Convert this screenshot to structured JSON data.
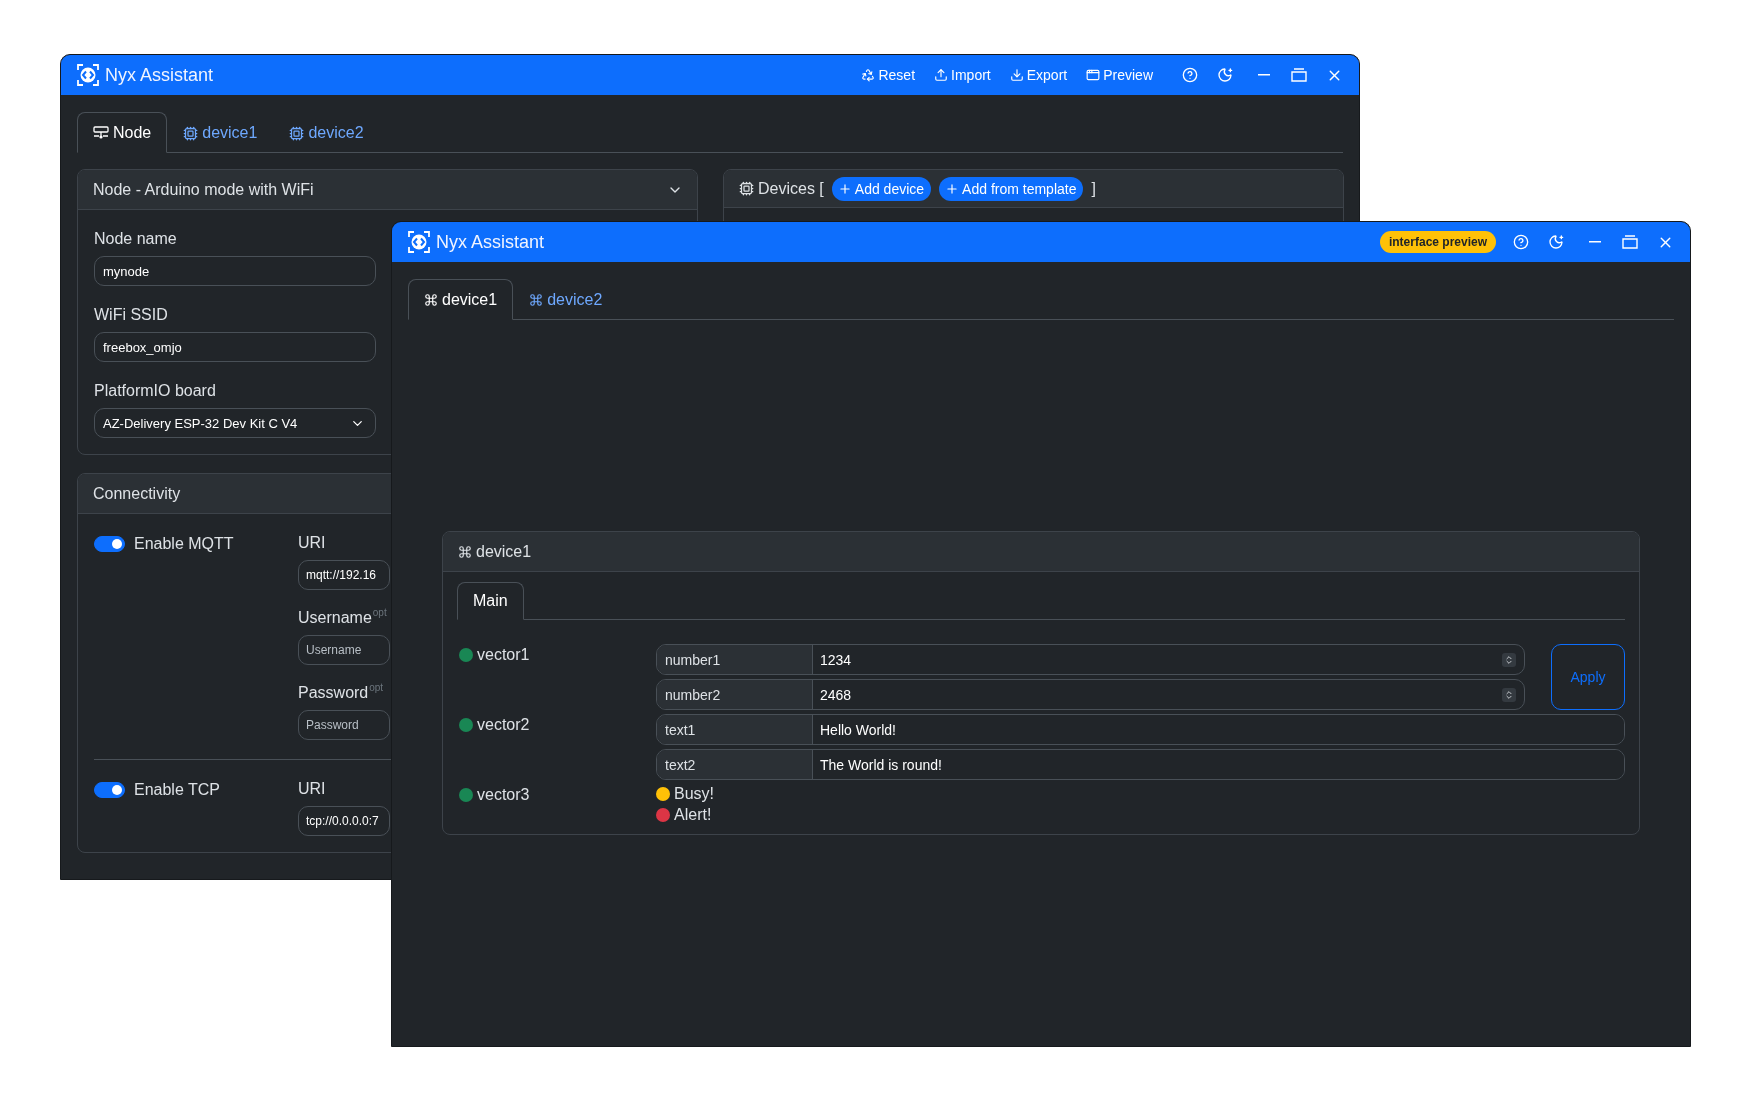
{
  "back_window": {
    "title": "Nyx Assistant",
    "toolbar": [
      {
        "label": "Reset",
        "kind": "reset"
      },
      {
        "label": "Import",
        "kind": "import"
      },
      {
        "label": "Export",
        "kind": "export"
      },
      {
        "label": "Preview",
        "kind": "preview"
      }
    ],
    "tabs": [
      {
        "label": "Node",
        "kind": "node",
        "selected": true
      },
      {
        "label": "device1",
        "kind": "device",
        "selected": false
      },
      {
        "label": "device2",
        "kind": "device",
        "selected": false
      }
    ],
    "node_panel": {
      "mode": "Node - Arduino mode with WiFi",
      "fields": [
        {
          "label": "Node name",
          "value": "mynode",
          "kind": "text"
        },
        {
          "label": "WiFi SSID",
          "value": "freebox_omjo",
          "kind": "text"
        },
        {
          "label": "PlatformIO board",
          "value": "AZ-Delivery ESP-32 Dev Kit C V4",
          "kind": "select"
        }
      ]
    },
    "connectivity": {
      "title": "Connectivity",
      "protocols": [
        {
          "label": "Enable MQTT",
          "on": true,
          "fields": [
            {
              "label": "URI",
              "value": "mqtt://192.16"
            },
            {
              "label": "Username",
              "note": "opt",
              "placeholder": "Username"
            },
            {
              "label": "Password",
              "note": "opt",
              "placeholder": "Password"
            }
          ]
        },
        {
          "label": "Enable TCP",
          "on": true,
          "fields": [
            {
              "label": "URI",
              "value": "tcp://0.0.0.0:7"
            }
          ]
        }
      ]
    },
    "devices_panel": {
      "title": "Devices [",
      "buttons": [
        "Add device",
        "Add from template"
      ],
      "closing": "]"
    }
  },
  "front_window": {
    "title": "Nyx Assistant",
    "badge": "interface preview",
    "tabs": [
      {
        "label": "device1",
        "selected": true
      },
      {
        "label": "device2",
        "selected": false
      }
    ],
    "device_card": {
      "title": "device1",
      "tabs": [
        {
          "label": "Main",
          "selected": true
        }
      ],
      "vectors": [
        {
          "name": "vector1",
          "color": "#198754",
          "apply": "Apply",
          "properties": [
            {
              "kind": "number",
              "label": "number1",
              "value": "1234"
            },
            {
              "kind": "number",
              "label": "number2",
              "value": "2468"
            }
          ]
        },
        {
          "name": "vector2",
          "color": "#198754",
          "properties": [
            {
              "kind": "text",
              "label": "text1",
              "value": "Hello World!"
            },
            {
              "kind": "text",
              "label": "text2",
              "value": "The World is round!"
            }
          ]
        },
        {
          "name": "vector3",
          "color": "#198754",
          "lights": [
            {
              "label": "Busy!",
              "color": "#ffc107"
            },
            {
              "label": "Alert!",
              "color": "#dc3545"
            }
          ]
        }
      ]
    }
  }
}
